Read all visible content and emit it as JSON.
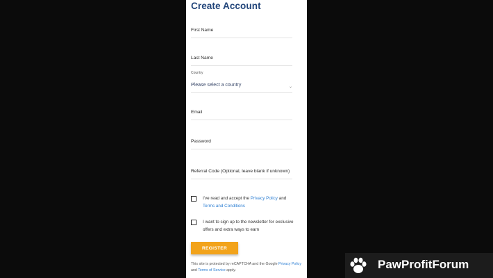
{
  "form": {
    "title": "Create Account",
    "first_name": {
      "placeholder": "First Name"
    },
    "last_name": {
      "placeholder": "Last Name"
    },
    "country": {
      "label": "Country",
      "value": "Please select a country"
    },
    "email": {
      "placeholder": "Email"
    },
    "password": {
      "placeholder": "Password"
    },
    "referral": {
      "placeholder": "Referral Code (Optional, leave blank if unknown)"
    },
    "terms": {
      "text_before": "I've read and accept the ",
      "privacy_link": "Privacy Policy",
      "text_mid": " and ",
      "terms_link": "Terms and Conditions",
      "checked": false
    },
    "newsletter": {
      "text": "I want to sign up to the newsletter for exclusive offers and extra ways to earn",
      "checked": false
    },
    "register_label": "REGISTER",
    "recaptcha": {
      "text_before": "This site is protected by reCAPTCHA and the Google ",
      "privacy_link": "Privacy Policy",
      "text_mid": " and ",
      "terms_link": "Terms of Service",
      "text_after": " apply."
    }
  },
  "watermark": {
    "brand": "PawProfitForum",
    "icon": "paw-icon"
  },
  "colors": {
    "title": "#22457a",
    "accent_button": "#f2a31b",
    "link": "#2d7fd3",
    "background": "#0b0b0b"
  }
}
